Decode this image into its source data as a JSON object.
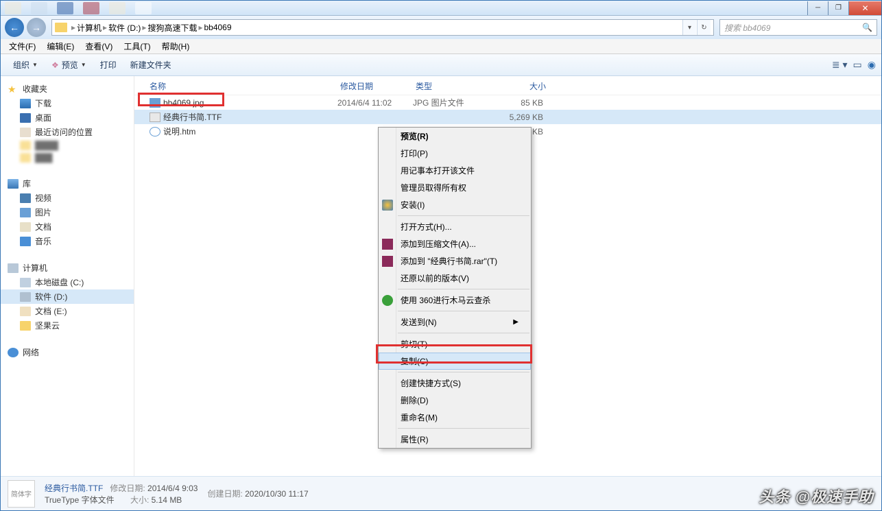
{
  "breadcrumbs": [
    "计算机",
    "软件 (D:)",
    "搜狗高速下载",
    "bb4069"
  ],
  "search_placeholder": "搜索 bb4069",
  "menus": [
    "文件(F)",
    "编辑(E)",
    "查看(V)",
    "工具(T)",
    "帮助(H)"
  ],
  "toolbar": {
    "org": "组织",
    "preview": "预览",
    "print": "打印",
    "newfolder": "新建文件夹"
  },
  "sidebar": {
    "fav": {
      "title": "收藏夹",
      "items": [
        "下载",
        "桌面",
        "最近访问的位置"
      ]
    },
    "lib": {
      "title": "库",
      "items": [
        "视频",
        "图片",
        "文档",
        "音乐"
      ]
    },
    "comp": {
      "title": "计算机",
      "items": [
        "本地磁盘 (C:)",
        "软件 (D:)",
        "文档 (E:)",
        "坚果云"
      ]
    },
    "net": {
      "title": "网络"
    }
  },
  "columns": {
    "name": "名称",
    "date": "修改日期",
    "type": "类型",
    "size": "大小"
  },
  "files": [
    {
      "name": "bb4069.jpg",
      "date": "2014/6/4 11:02",
      "type": "JPG 图片文件",
      "size": "85 KB"
    },
    {
      "name": "经典行书简.TTF",
      "date": "",
      "type": "",
      "size": "5,269 KB"
    },
    {
      "name": "说明.htm",
      "date": "",
      "type": "",
      "size": "4 KB"
    }
  ],
  "ctx": {
    "preview": "预览(R)",
    "print": "打印(P)",
    "notepad": "用记事本打开该文件",
    "admin": "管理员取得所有权",
    "install": "安装(I)",
    "openwith": "打开方式(H)...",
    "addarchive": "添加到压缩文件(A)...",
    "addrar": "添加到 \"经典行书简.rar\"(T)",
    "restore": "还原以前的版本(V)",
    "scan360": "使用 360进行木马云查杀",
    "sendto": "发送到(N)",
    "cut": "剪切(T)",
    "copy": "复制(C)",
    "shortcut": "创建快捷方式(S)",
    "delete": "删除(D)",
    "rename": "重命名(M)",
    "props": "属性(R)"
  },
  "status": {
    "thumb": "简体字",
    "filename": "经典行书简.TTF",
    "filetype": "TrueType 字体文件",
    "mod_lbl": "修改日期:",
    "mod_val": "2014/6/4 9:03",
    "size_lbl": "大小:",
    "size_val": "5.14 MB",
    "create_lbl": "创建日期:",
    "create_val": "2020/10/30 11:17"
  },
  "watermark": "头条 @极速手助"
}
